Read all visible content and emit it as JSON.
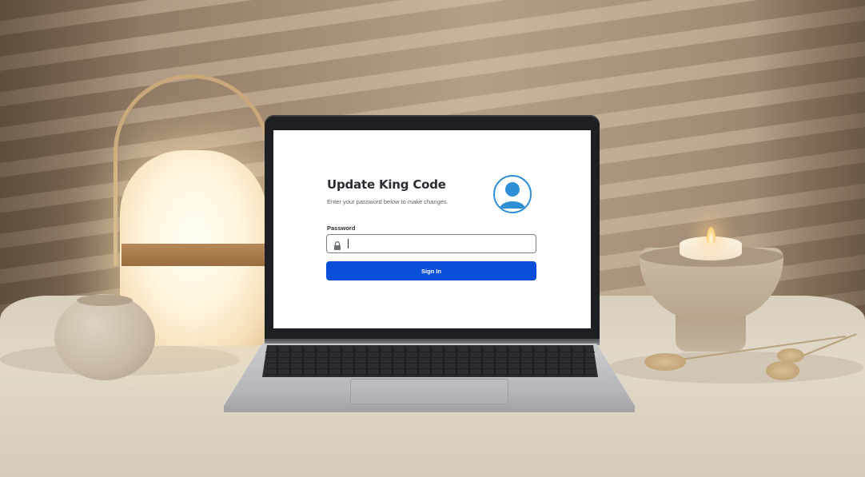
{
  "app": {
    "title": "Update King Code",
    "subtitle": "Enter your password below to make changes."
  },
  "form": {
    "password_label": "Password",
    "password_value": "",
    "submit_label": "Sign In"
  },
  "icons": {
    "avatar": "user-avatar-icon",
    "lock": "lock-icon"
  },
  "colors": {
    "primary_button": "#0b4fd9",
    "avatar_accent": "#2f8fd6"
  }
}
